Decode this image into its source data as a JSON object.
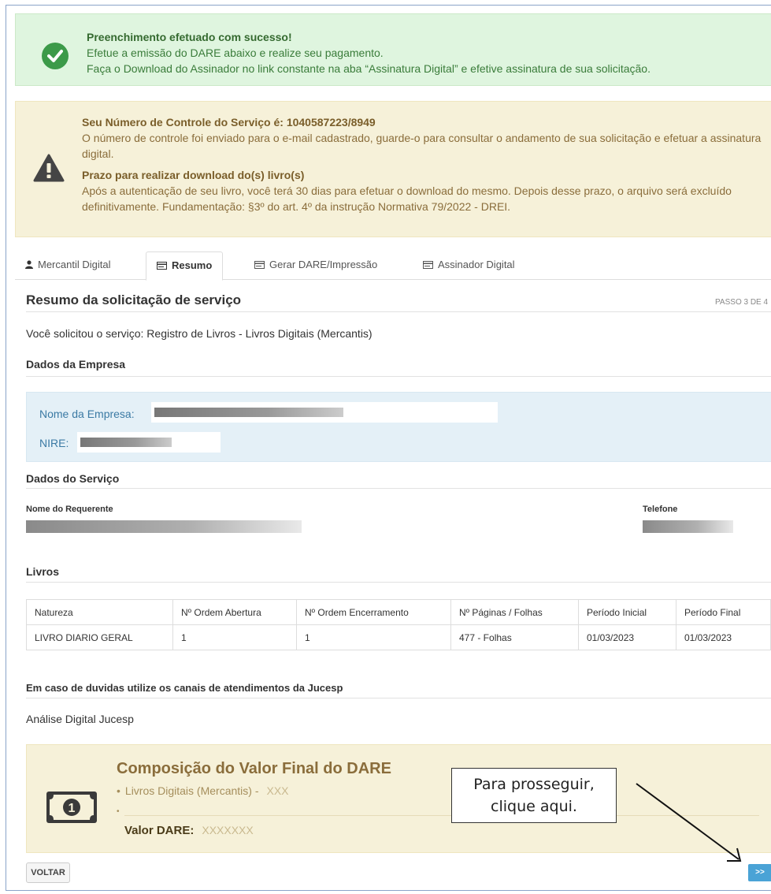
{
  "success_alert": {
    "title": "Preenchimento efetuado com sucesso!",
    "line1": "Efetue a emissão do DARE abaixo e realize seu pagamento.",
    "line2": "Faça o Download do Assinador no link constante na aba “Assinatura Digital” e efetive assinatura de sua solicitação."
  },
  "warning_alert": {
    "control_title": "Seu Número de Controle do Serviço é: 1040587223/8949",
    "control_text": "O número de controle foi enviado para o e-mail cadastrado, guarde-o para consultar o andamento de sua solicitação e efetuar a assinatura digital.",
    "deadline_title": "Prazo para realizar download do(s) livro(s)",
    "deadline_text": "Após a autenticação de seu livro, você terá 30 dias para efetuar o download do mesmo. Depois desse prazo, o arquivo será excluído definitivamente. Fundamentação: §3º do art. 4º da instrução Normativa 79/2022 - DREI."
  },
  "tabs": [
    {
      "label": "Mercantil Digital",
      "icon": "user-icon"
    },
    {
      "label": "Resumo",
      "icon": "card-icon"
    },
    {
      "label": "Gerar DARE/Impressão",
      "icon": "card-icon"
    },
    {
      "label": "Assinador Digital",
      "icon": "card-icon"
    }
  ],
  "summary": {
    "title": "Resumo da solicitação de serviço",
    "step": "PASSO 3 DE 4",
    "service_text": "Você solicitou o serviço: Registro de Livros - Livros Digitais (Mercantis)"
  },
  "company": {
    "heading": "Dados da Empresa",
    "name_label": "Nome da Empresa:",
    "nire_label": "NIRE:"
  },
  "service": {
    "heading": "Dados do Serviço",
    "requester_label": "Nome do Requerente",
    "phone_label": "Telefone"
  },
  "books": {
    "heading": "Livros",
    "columns": [
      "Natureza",
      "Nº Ordem Abertura",
      "Nº Ordem Encerramento",
      "Nº Páginas / Folhas",
      "Período Inicial",
      "Período Final"
    ],
    "rows": [
      [
        "LIVRO DIARIO GERAL",
        "1",
        "1",
        "477 - Folhas",
        "01/03/2023",
        "01/03/2023"
      ]
    ]
  },
  "support": {
    "heading": "Em caso de duvidas utilize os canais de atendimentos da Jucesp",
    "text": "Análise Digital Jucesp"
  },
  "dare": {
    "title": "Composição do Valor Final do DARE",
    "item_label": "Livros Digitais (Mercantis) -",
    "item_value": "XXX",
    "valor_label": "Valor DARE:",
    "valor_value": "XXXXXXX"
  },
  "callout": {
    "line1": "Para prosseguir,",
    "line2": "clique aqui."
  },
  "buttons": {
    "back": "VOLTAR",
    "next": ">>"
  },
  "colors": {
    "success_bg": "#dff5df",
    "warning_bg": "#f6f1d9",
    "info_bg": "#e4f0f7",
    "next_button": "#4aa3d6"
  }
}
